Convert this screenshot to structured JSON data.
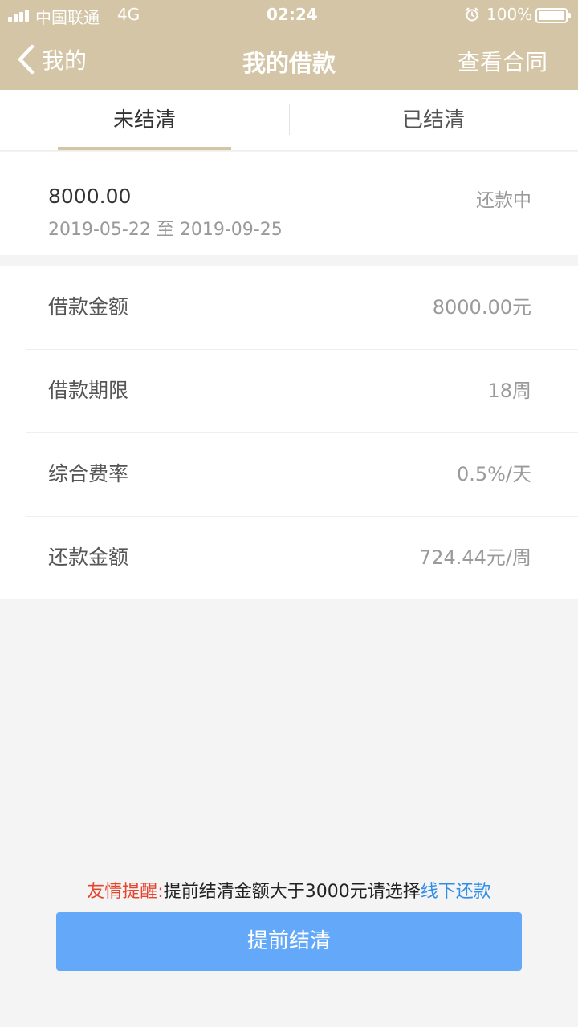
{
  "status_bar": {
    "carrier": "中国联通",
    "network": "4G",
    "time": "02:24",
    "battery": "100%"
  },
  "nav": {
    "back_label": "我的",
    "title": "我的借款",
    "action_label": "查看合同"
  },
  "tabs": [
    {
      "label": "未结清",
      "active": true
    },
    {
      "label": "已结清",
      "active": false
    }
  ],
  "loan_summary": {
    "amount": "8000.00",
    "period": "2019-05-22 至 2019-09-25",
    "status": "还款中"
  },
  "loan_details": [
    {
      "label": "借款金额",
      "value": "8000.00元"
    },
    {
      "label": "借款期限",
      "value": "18周"
    },
    {
      "label": "综合费率",
      "value": "0.5%/天"
    },
    {
      "label": "还款金额",
      "value": "724.44元/周"
    }
  ],
  "notice": {
    "prefix": "友情提醒:",
    "text": "提前结清金额大于3000元请选择",
    "link": "线下还款"
  },
  "cta_label": "提前结清",
  "colors": {
    "header_bg": "#d3c5a5",
    "tab_indicator": "#d3c5a5",
    "button_bg": "#64a9f9",
    "notice_prefix": "#e8432d",
    "notice_link": "#2f8ee6",
    "page_bg": "#f4f4f4"
  },
  "icons": [
    "signal-icon",
    "alarm-icon",
    "battery-icon",
    "back-chevron-icon"
  ]
}
